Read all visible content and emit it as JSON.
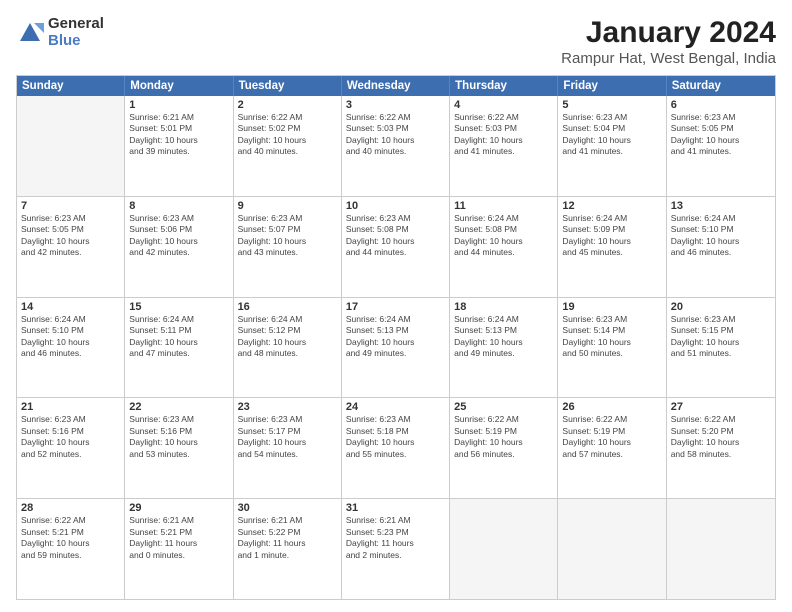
{
  "logo": {
    "general": "General",
    "blue": "Blue"
  },
  "title": "January 2024",
  "subtitle": "Rampur Hat, West Bengal, India",
  "header_days": [
    "Sunday",
    "Monday",
    "Tuesday",
    "Wednesday",
    "Thursday",
    "Friday",
    "Saturday"
  ],
  "weeks": [
    [
      {
        "day": "",
        "lines": []
      },
      {
        "day": "1",
        "lines": [
          "Sunrise: 6:21 AM",
          "Sunset: 5:01 PM",
          "Daylight: 10 hours",
          "and 39 minutes."
        ]
      },
      {
        "day": "2",
        "lines": [
          "Sunrise: 6:22 AM",
          "Sunset: 5:02 PM",
          "Daylight: 10 hours",
          "and 40 minutes."
        ]
      },
      {
        "day": "3",
        "lines": [
          "Sunrise: 6:22 AM",
          "Sunset: 5:03 PM",
          "Daylight: 10 hours",
          "and 40 minutes."
        ]
      },
      {
        "day": "4",
        "lines": [
          "Sunrise: 6:22 AM",
          "Sunset: 5:03 PM",
          "Daylight: 10 hours",
          "and 41 minutes."
        ]
      },
      {
        "day": "5",
        "lines": [
          "Sunrise: 6:23 AM",
          "Sunset: 5:04 PM",
          "Daylight: 10 hours",
          "and 41 minutes."
        ]
      },
      {
        "day": "6",
        "lines": [
          "Sunrise: 6:23 AM",
          "Sunset: 5:05 PM",
          "Daylight: 10 hours",
          "and 41 minutes."
        ]
      }
    ],
    [
      {
        "day": "7",
        "lines": [
          "Sunrise: 6:23 AM",
          "Sunset: 5:05 PM",
          "Daylight: 10 hours",
          "and 42 minutes."
        ]
      },
      {
        "day": "8",
        "lines": [
          "Sunrise: 6:23 AM",
          "Sunset: 5:06 PM",
          "Daylight: 10 hours",
          "and 42 minutes."
        ]
      },
      {
        "day": "9",
        "lines": [
          "Sunrise: 6:23 AM",
          "Sunset: 5:07 PM",
          "Daylight: 10 hours",
          "and 43 minutes."
        ]
      },
      {
        "day": "10",
        "lines": [
          "Sunrise: 6:23 AM",
          "Sunset: 5:08 PM",
          "Daylight: 10 hours",
          "and 44 minutes."
        ]
      },
      {
        "day": "11",
        "lines": [
          "Sunrise: 6:24 AM",
          "Sunset: 5:08 PM",
          "Daylight: 10 hours",
          "and 44 minutes."
        ]
      },
      {
        "day": "12",
        "lines": [
          "Sunrise: 6:24 AM",
          "Sunset: 5:09 PM",
          "Daylight: 10 hours",
          "and 45 minutes."
        ]
      },
      {
        "day": "13",
        "lines": [
          "Sunrise: 6:24 AM",
          "Sunset: 5:10 PM",
          "Daylight: 10 hours",
          "and 46 minutes."
        ]
      }
    ],
    [
      {
        "day": "14",
        "lines": [
          "Sunrise: 6:24 AM",
          "Sunset: 5:10 PM",
          "Daylight: 10 hours",
          "and 46 minutes."
        ]
      },
      {
        "day": "15",
        "lines": [
          "Sunrise: 6:24 AM",
          "Sunset: 5:11 PM",
          "Daylight: 10 hours",
          "and 47 minutes."
        ]
      },
      {
        "day": "16",
        "lines": [
          "Sunrise: 6:24 AM",
          "Sunset: 5:12 PM",
          "Daylight: 10 hours",
          "and 48 minutes."
        ]
      },
      {
        "day": "17",
        "lines": [
          "Sunrise: 6:24 AM",
          "Sunset: 5:13 PM",
          "Daylight: 10 hours",
          "and 49 minutes."
        ]
      },
      {
        "day": "18",
        "lines": [
          "Sunrise: 6:24 AM",
          "Sunset: 5:13 PM",
          "Daylight: 10 hours",
          "and 49 minutes."
        ]
      },
      {
        "day": "19",
        "lines": [
          "Sunrise: 6:23 AM",
          "Sunset: 5:14 PM",
          "Daylight: 10 hours",
          "and 50 minutes."
        ]
      },
      {
        "day": "20",
        "lines": [
          "Sunrise: 6:23 AM",
          "Sunset: 5:15 PM",
          "Daylight: 10 hours",
          "and 51 minutes."
        ]
      }
    ],
    [
      {
        "day": "21",
        "lines": [
          "Sunrise: 6:23 AM",
          "Sunset: 5:16 PM",
          "Daylight: 10 hours",
          "and 52 minutes."
        ]
      },
      {
        "day": "22",
        "lines": [
          "Sunrise: 6:23 AM",
          "Sunset: 5:16 PM",
          "Daylight: 10 hours",
          "and 53 minutes."
        ]
      },
      {
        "day": "23",
        "lines": [
          "Sunrise: 6:23 AM",
          "Sunset: 5:17 PM",
          "Daylight: 10 hours",
          "and 54 minutes."
        ]
      },
      {
        "day": "24",
        "lines": [
          "Sunrise: 6:23 AM",
          "Sunset: 5:18 PM",
          "Daylight: 10 hours",
          "and 55 minutes."
        ]
      },
      {
        "day": "25",
        "lines": [
          "Sunrise: 6:22 AM",
          "Sunset: 5:19 PM",
          "Daylight: 10 hours",
          "and 56 minutes."
        ]
      },
      {
        "day": "26",
        "lines": [
          "Sunrise: 6:22 AM",
          "Sunset: 5:19 PM",
          "Daylight: 10 hours",
          "and 57 minutes."
        ]
      },
      {
        "day": "27",
        "lines": [
          "Sunrise: 6:22 AM",
          "Sunset: 5:20 PM",
          "Daylight: 10 hours",
          "and 58 minutes."
        ]
      }
    ],
    [
      {
        "day": "28",
        "lines": [
          "Sunrise: 6:22 AM",
          "Sunset: 5:21 PM",
          "Daylight: 10 hours",
          "and 59 minutes."
        ]
      },
      {
        "day": "29",
        "lines": [
          "Sunrise: 6:21 AM",
          "Sunset: 5:21 PM",
          "Daylight: 11 hours",
          "and 0 minutes."
        ]
      },
      {
        "day": "30",
        "lines": [
          "Sunrise: 6:21 AM",
          "Sunset: 5:22 PM",
          "Daylight: 11 hours",
          "and 1 minute."
        ]
      },
      {
        "day": "31",
        "lines": [
          "Sunrise: 6:21 AM",
          "Sunset: 5:23 PM",
          "Daylight: 11 hours",
          "and 2 minutes."
        ]
      },
      {
        "day": "",
        "lines": []
      },
      {
        "day": "",
        "lines": []
      },
      {
        "day": "",
        "lines": []
      }
    ]
  ]
}
